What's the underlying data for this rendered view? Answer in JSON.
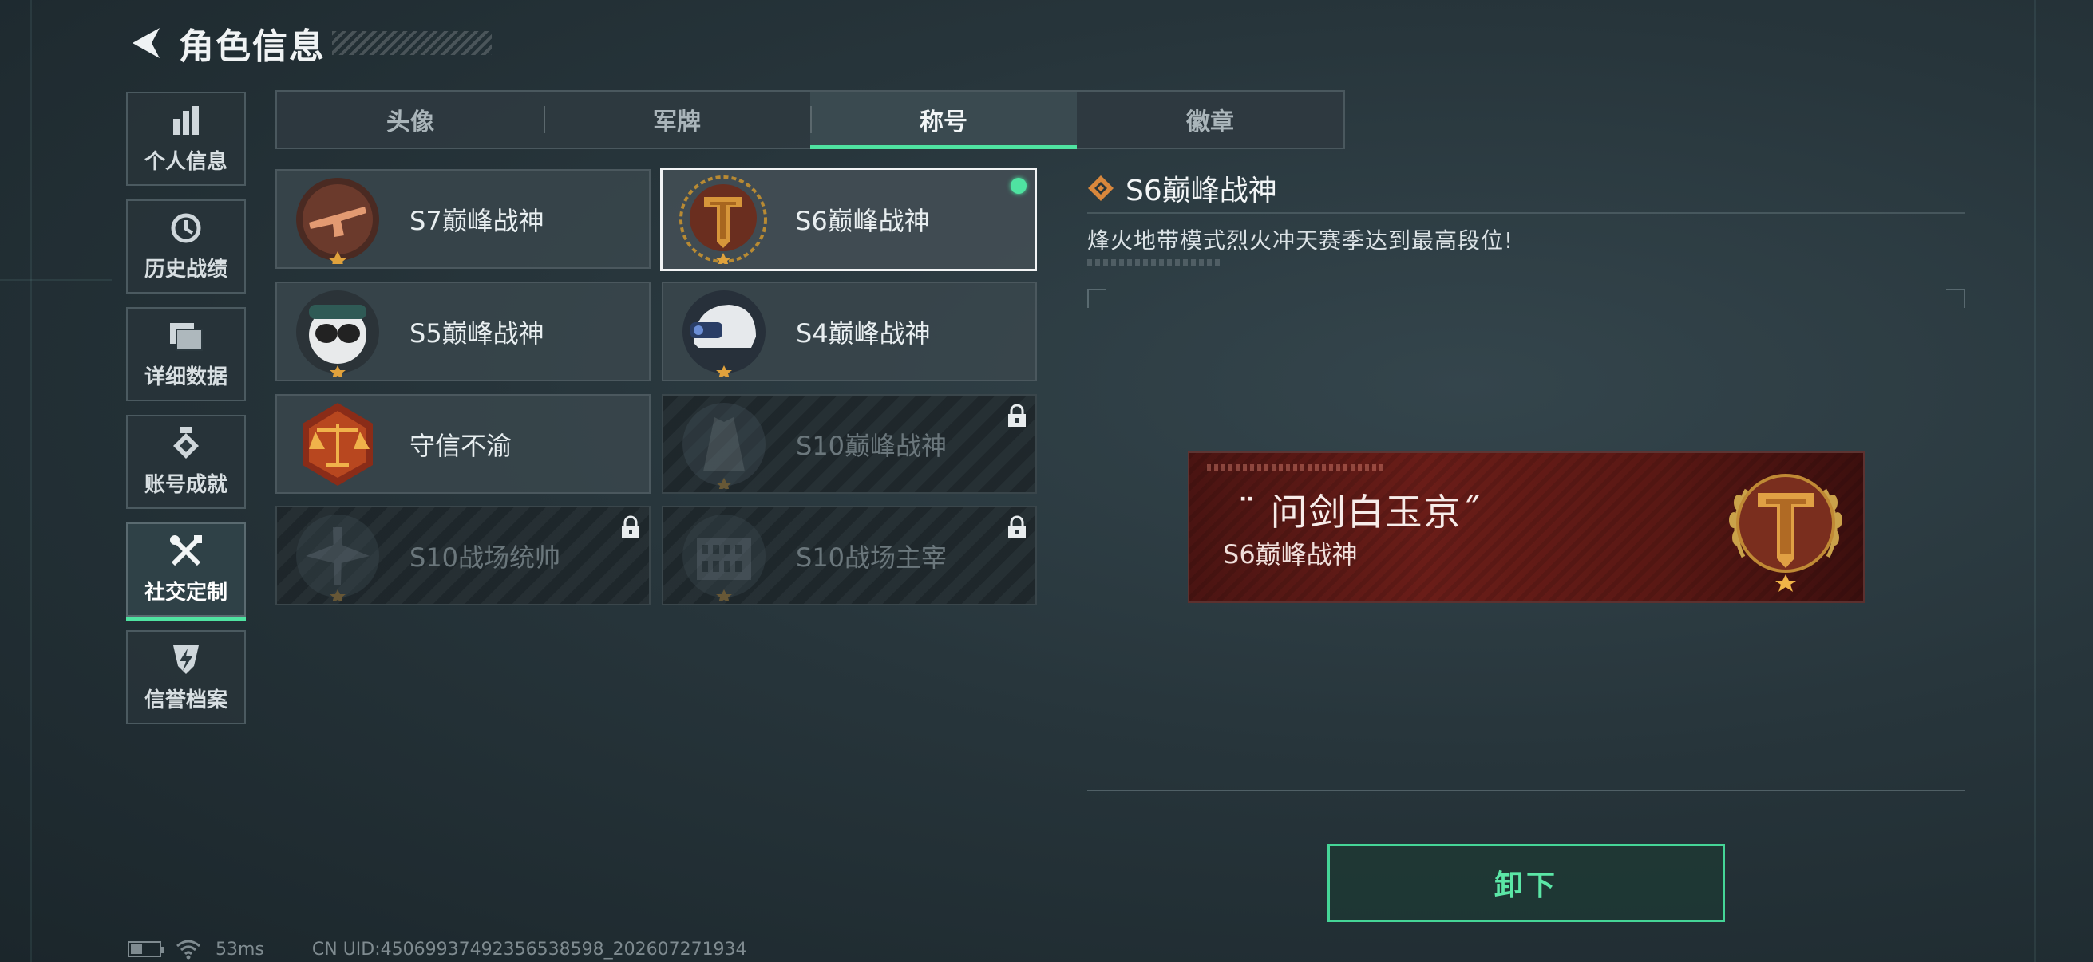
{
  "header": {
    "title": "角色信息"
  },
  "sidebar": {
    "items": [
      {
        "label": "个人信息",
        "icon": "bar-chart-icon",
        "active": false
      },
      {
        "label": "历史战绩",
        "icon": "history-clock-icon",
        "active": false
      },
      {
        "label": "详细数据",
        "icon": "folder-icon",
        "active": false
      },
      {
        "label": "账号成就",
        "icon": "medal-icon",
        "active": false
      },
      {
        "label": "社交定制",
        "icon": "wrench-screwdriver-icon",
        "active": true
      },
      {
        "label": "信誉档案",
        "icon": "shield-bolt-icon",
        "active": false
      }
    ]
  },
  "tabs": [
    {
      "label": "头像",
      "active": false
    },
    {
      "label": "军牌",
      "active": false
    },
    {
      "label": "称号",
      "active": true
    },
    {
      "label": "徽章",
      "active": false
    }
  ],
  "titles": [
    {
      "label": "S7巅峰战神",
      "emblem": "rifle-emblem",
      "state": "owned"
    },
    {
      "label": "S6巅峰战神",
      "emblem": "t-shield-emblem",
      "state": "selected-equipped"
    },
    {
      "label": "S5巅峰战神",
      "emblem": "skull-goggles-emblem",
      "state": "owned"
    },
    {
      "label": "S4巅峰战神",
      "emblem": "helmet-emblem",
      "state": "owned"
    },
    {
      "label": "守信不渝",
      "emblem": "scales-emblem",
      "state": "owned"
    },
    {
      "label": "S10巅峰战神",
      "emblem": "tower-emblem",
      "state": "locked"
    },
    {
      "label": "S10战场统帅",
      "emblem": "aircraft-emblem",
      "state": "locked"
    },
    {
      "label": "S10战场主宰",
      "emblem": "colosseum-emblem",
      "state": "locked"
    }
  ],
  "detail": {
    "title": "S6巅峰战神",
    "description": "烽火地带模式烈火冲天赛季达到最高段位!",
    "banner_quote": "¨ 问剑白玉京˝",
    "banner_subtitle": "S6巅峰战神"
  },
  "action": {
    "unequip_label": "卸下"
  },
  "status_bar": {
    "ping": "53ms",
    "uid": "CN UID:4506993749235653859​8_202607271934"
  },
  "colors": {
    "accent": "#4fe3a1",
    "banner": "#6a1d18",
    "gold": "#c8933d"
  }
}
